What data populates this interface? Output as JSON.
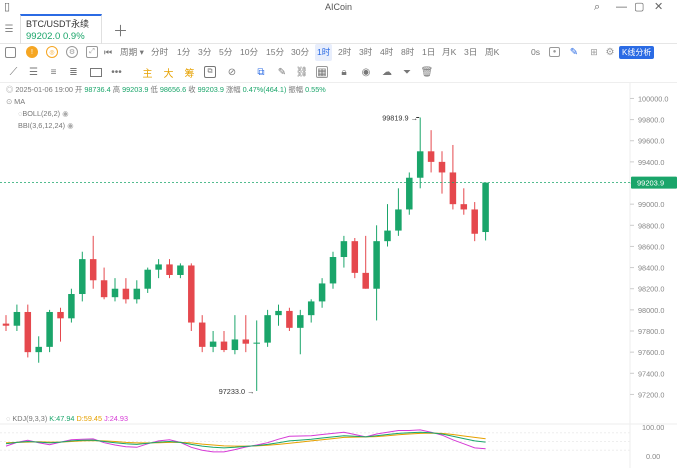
{
  "window": {
    "title": "AICoin"
  },
  "tab": {
    "pair": "BTC/USDT永续",
    "price": "99202.0",
    "change": "0.9%"
  },
  "toolbar": {
    "period_label": "周期",
    "intervals": [
      "分时",
      "1分",
      "3分",
      "5分",
      "10分",
      "15分",
      "30分",
      "1时",
      "2时",
      "3时",
      "4时",
      "8时",
      "1日",
      "月K",
      "3日",
      "周K"
    ],
    "active_interval": "1时",
    "countdown": "0s",
    "kline_analysis_label": "K线分析",
    "tools": [
      "主",
      "大",
      "筹"
    ]
  },
  "ohlc": {
    "datetime": "2025-01-06 19:00",
    "open_label": "开",
    "open": "98736.4",
    "high_label": "高",
    "high": "99203.9",
    "low_label": "低",
    "low": "98656.6",
    "close_label": "收",
    "close": "99203.9",
    "change_label": "涨幅",
    "change": "0.47%(464.1)",
    "amplitude_label": "振幅",
    "amplitude": "0.55%"
  },
  "indicators": {
    "ma": "MA",
    "boll": "BOLL(26,2)",
    "bbi": "BBI(3,6,12,24)"
  },
  "kdj": {
    "label": "KDJ(9,3,3)",
    "k": "K:47.94",
    "d": "D:59.45",
    "j": "J:24.93"
  },
  "price_axis": {
    "ticks": [
      "100000.0",
      "99800.0",
      "99600.0",
      "99400.0",
      "99200.0",
      "99000.0",
      "98800.0",
      "98600.0",
      "98400.0",
      "98200.0",
      "98000.0",
      "97800.0",
      "97600.0",
      "97400.0",
      "97200.0"
    ],
    "current": "99203.9"
  },
  "kdj_axis": {
    "ticks": [
      "100.00",
      "0.00"
    ]
  },
  "annotations": {
    "high": "99819.9",
    "low": "97233.0"
  },
  "colors": {
    "up": "#1aa56a",
    "down": "#e5484d",
    "accent": "#2b6be4"
  },
  "chart_data": {
    "type": "candlestick",
    "ylim": [
      97100,
      100080
    ],
    "candles": [
      {
        "o": 97870,
        "h": 97950,
        "l": 97800,
        "c": 97850
      },
      {
        "o": 97850,
        "h": 98050,
        "l": 97800,
        "c": 97980
      },
      {
        "o": 97980,
        "h": 98050,
        "l": 97550,
        "c": 97600
      },
      {
        "o": 97600,
        "h": 97750,
        "l": 97500,
        "c": 97650
      },
      {
        "o": 97650,
        "h": 98000,
        "l": 97600,
        "c": 97980
      },
      {
        "o": 97980,
        "h": 98020,
        "l": 97700,
        "c": 97920
      },
      {
        "o": 97920,
        "h": 98200,
        "l": 97880,
        "c": 98150
      },
      {
        "o": 98150,
        "h": 98550,
        "l": 98080,
        "c": 98480
      },
      {
        "o": 98480,
        "h": 98700,
        "l": 98200,
        "c": 98280
      },
      {
        "o": 98280,
        "h": 98400,
        "l": 98100,
        "c": 98120
      },
      {
        "o": 98120,
        "h": 98300,
        "l": 98080,
        "c": 98200
      },
      {
        "o": 98200,
        "h": 98300,
        "l": 98060,
        "c": 98100
      },
      {
        "o": 98100,
        "h": 98280,
        "l": 98060,
        "c": 98200
      },
      {
        "o": 98200,
        "h": 98400,
        "l": 98160,
        "c": 98380
      },
      {
        "o": 98380,
        "h": 98480,
        "l": 98300,
        "c": 98430
      },
      {
        "o": 98430,
        "h": 98480,
        "l": 98300,
        "c": 98330
      },
      {
        "o": 98330,
        "h": 98440,
        "l": 98300,
        "c": 98420
      },
      {
        "o": 98420,
        "h": 98440,
        "l": 97800,
        "c": 97880
      },
      {
        "o": 97880,
        "h": 97950,
        "l": 97600,
        "c": 97650
      },
      {
        "o": 97650,
        "h": 97800,
        "l": 97600,
        "c": 97700
      },
      {
        "o": 97700,
        "h": 97800,
        "l": 97600,
        "c": 97620
      },
      {
        "o": 97620,
        "h": 97950,
        "l": 97580,
        "c": 97720
      },
      {
        "o": 97720,
        "h": 97950,
        "l": 97600,
        "c": 97680
      },
      {
        "o": 97680,
        "h": 97900,
        "l": 97233,
        "c": 97690
      },
      {
        "o": 97690,
        "h": 98000,
        "l": 97650,
        "c": 97950
      },
      {
        "o": 97950,
        "h": 98050,
        "l": 97850,
        "c": 97990
      },
      {
        "o": 97990,
        "h": 98020,
        "l": 97800,
        "c": 97830
      },
      {
        "o": 97830,
        "h": 98000,
        "l": 97580,
        "c": 97950
      },
      {
        "o": 97950,
        "h": 98100,
        "l": 97880,
        "c": 98080
      },
      {
        "o": 98080,
        "h": 98300,
        "l": 98020,
        "c": 98250
      },
      {
        "o": 98250,
        "h": 98550,
        "l": 98200,
        "c": 98500
      },
      {
        "o": 98500,
        "h": 98700,
        "l": 98400,
        "c": 98650
      },
      {
        "o": 98650,
        "h": 98680,
        "l": 98300,
        "c": 98350
      },
      {
        "o": 98350,
        "h": 98700,
        "l": 98200,
        "c": 98200
      },
      {
        "o": 98200,
        "h": 98800,
        "l": 97900,
        "c": 98650
      },
      {
        "o": 98650,
        "h": 99000,
        "l": 98600,
        "c": 98750
      },
      {
        "o": 98750,
        "h": 99150,
        "l": 98700,
        "c": 98950
      },
      {
        "o": 98950,
        "h": 99300,
        "l": 98900,
        "c": 99250
      },
      {
        "o": 99250,
        "h": 99819.9,
        "l": 99150,
        "c": 99500
      },
      {
        "o": 99500,
        "h": 99700,
        "l": 99300,
        "c": 99400
      },
      {
        "o": 99400,
        "h": 99500,
        "l": 99100,
        "c": 99300
      },
      {
        "o": 99300,
        "h": 99560,
        "l": 98950,
        "c": 99000
      },
      {
        "o": 99000,
        "h": 99150,
        "l": 98900,
        "c": 98950
      },
      {
        "o": 98950,
        "h": 99020,
        "l": 98650,
        "c": 98720
      },
      {
        "o": 98736.4,
        "h": 99203.9,
        "l": 98656.6,
        "c": 99203.9
      }
    ],
    "kdj_k": [
      42,
      47,
      50,
      48,
      45,
      48,
      52,
      54,
      55,
      50,
      46,
      42,
      40,
      44,
      48,
      50,
      47,
      40,
      34,
      30,
      28,
      30,
      33,
      36,
      40,
      46,
      52,
      55,
      58,
      62,
      66,
      70,
      68,
      66,
      70,
      74,
      78,
      80,
      82,
      80,
      76,
      68,
      60,
      52,
      47.94
    ],
    "kdj_d": [
      46,
      47,
      48,
      49,
      48,
      48,
      50,
      52,
      53,
      52,
      50,
      47,
      45,
      45,
      46,
      47,
      47,
      45,
      41,
      38,
      35,
      34,
      34,
      35,
      37,
      40,
      44,
      48,
      52,
      56,
      60,
      64,
      65,
      66,
      67,
      70,
      73,
      76,
      78,
      79,
      78,
      74,
      69,
      64,
      59.45
    ],
    "kdj_j": [
      34,
      47,
      54,
      46,
      39,
      48,
      56,
      58,
      59,
      46,
      38,
      32,
      30,
      42,
      52,
      56,
      47,
      30,
      20,
      14,
      14,
      22,
      31,
      38,
      46,
      58,
      68,
      69,
      70,
      74,
      78,
      82,
      74,
      66,
      76,
      82,
      88,
      88,
      90,
      82,
      72,
      56,
      42,
      28,
      24.93
    ]
  }
}
